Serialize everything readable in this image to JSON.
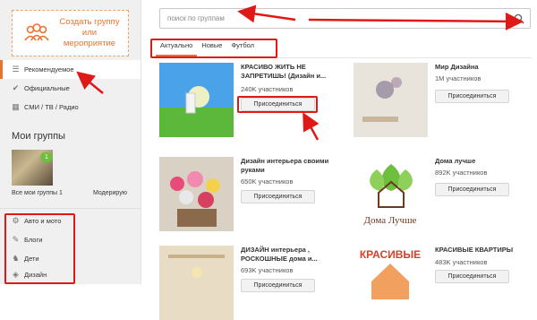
{
  "sidebar": {
    "create_button_label": "Создать группу или мероприятие",
    "nav": [
      {
        "label": "Рекомендуемое",
        "icon": "list-icon"
      },
      {
        "label": "Официальные",
        "icon": "check-circle-icon"
      },
      {
        "label": "СМИ / ТВ / Радио",
        "icon": "media-icon"
      }
    ],
    "my_groups_title": "Мои группы",
    "my_group_badge": "1",
    "all_my_groups": "Все мои группы 1",
    "moderation": "Модерирую",
    "categories": [
      {
        "label": "Авто и мото",
        "icon": "car-icon"
      },
      {
        "label": "Блоги",
        "icon": "pencil-icon"
      },
      {
        "label": "Дети",
        "icon": "horse-icon"
      },
      {
        "label": "Дизайн",
        "icon": "design-icon"
      }
    ]
  },
  "search": {
    "placeholder": "поиск по группам"
  },
  "tabs": [
    {
      "label": "Актуально",
      "active": true
    },
    {
      "label": "Новые",
      "active": false
    },
    {
      "label": "Футбол",
      "active": false
    }
  ],
  "groups": [
    {
      "title": "КРАСИВО ЖИТЬ НЕ ЗАПРЕТИШЬ! (Дизайн и...",
      "members": "240K участников",
      "join": "Присоединиться"
    },
    {
      "title": "Мир Дизайна",
      "members": "1M участников",
      "join": "Присоединиться"
    },
    {
      "title": "Дизайн интерьера своими руками",
      "members": "650K участников",
      "join": "Присоединиться"
    },
    {
      "title": "Дома лучше",
      "members": "892K участников",
      "join": "Присоединиться"
    },
    {
      "title": "ДИЗАЙН интерьера , РОСКОШНЫЕ дома и...",
      "members": "693K участников",
      "join": "Присоединиться"
    },
    {
      "title": "КРАСИВЫЕ КВАРТИРЫ",
      "members": "483K участников",
      "join": "Присоединиться"
    }
  ],
  "logo_text": {
    "doma": "Дома Лучше",
    "krasivye": "КРАСИВЫЕ"
  },
  "colors": {
    "accent": "#eb722e",
    "annotation_red": "#e01818",
    "badge_green": "#6fbf3f"
  }
}
